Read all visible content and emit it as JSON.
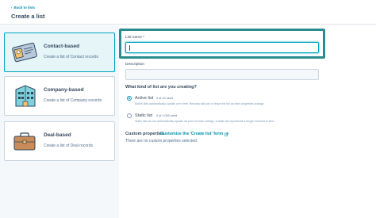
{
  "header": {
    "back_label": "Back to lists",
    "title": "Create a list"
  },
  "cards": [
    {
      "title": "Contact-based",
      "desc": "Create a list of Contact records",
      "icon": "contact-card-icon",
      "selected": true
    },
    {
      "title": "Company-based",
      "desc": "Create a list of Company records",
      "icon": "company-building-icon",
      "selected": false
    },
    {
      "title": "Deal-based",
      "desc": "Create a list of Deal records",
      "icon": "deal-briefcase-icon",
      "selected": false
    }
  ],
  "form": {
    "list_name_label": "List name *",
    "list_name_value": "",
    "description_label": "Description",
    "description_value": "",
    "list_type_question": "What kind of list are you creating?",
    "options": [
      {
        "label": "Active list",
        "used": "3 of 10 used",
        "desc": "Active lists automatically update over time. Records will join or leave the list as their properties change.",
        "checked": true
      },
      {
        "label": "Static list",
        "used": "0 of 1,000 used",
        "desc": "Static lists do not automatically update as your records change. A static list represents a single moment in time.",
        "checked": false
      }
    ],
    "custom_properties_label": "Custom properties",
    "custom_properties_link": "Customize the 'Create list' form",
    "custom_properties_empty": "There are no custom properties selected."
  },
  "colors": {
    "accent": "#00a4bd",
    "link": "#0091ae",
    "highlight_frame": "#2a8c8c",
    "text": "#33475b"
  }
}
